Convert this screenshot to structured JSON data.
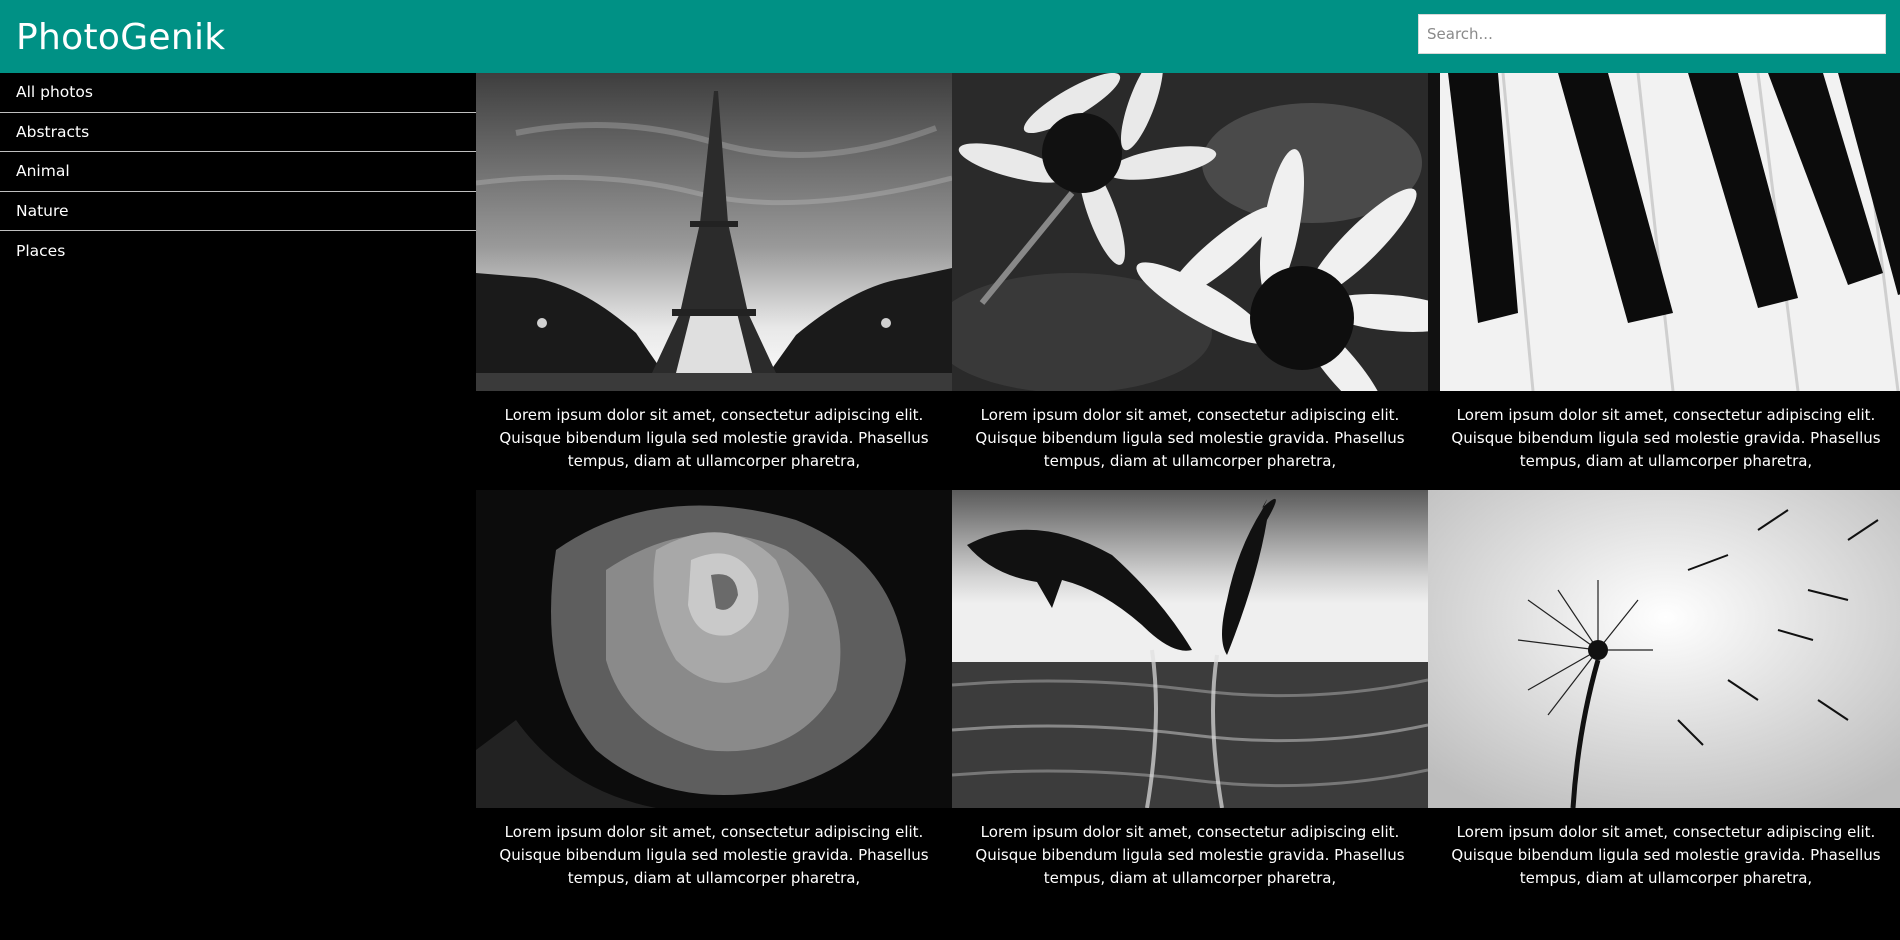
{
  "app": {
    "title": "PhotoGenik",
    "brand_color": "#009185"
  },
  "search": {
    "placeholder": "Search...",
    "value": ""
  },
  "sidebar": {
    "items": [
      {
        "label": "All photos"
      },
      {
        "label": "Abstracts"
      },
      {
        "label": "Animal"
      },
      {
        "label": "Nature"
      },
      {
        "label": "Places"
      }
    ]
  },
  "gallery": {
    "photos": [
      {
        "subject": "eiffel-tower",
        "caption": "Lorem ipsum dolor sit amet, consectetur adipiscing elit. Quisque bibendum ligula sed molestie gravida. Phasellus tempus, diam at ullamcorper pharetra,"
      },
      {
        "subject": "daisies",
        "caption": "Lorem ipsum dolor sit amet, consectetur adipiscing elit. Quisque bibendum ligula sed molestie gravida. Phasellus tempus, diam at ullamcorper pharetra,"
      },
      {
        "subject": "piano-keys",
        "caption": "Lorem ipsum dolor sit amet, consectetur adipiscing elit. Quisque bibendum ligula sed molestie gravida. Phasellus tempus, diam at ullamcorper pharetra,"
      },
      {
        "subject": "rose",
        "caption": "Lorem ipsum dolor sit amet, consectetur adipiscing elit. Quisque bibendum ligula sed molestie gravida. Phasellus tempus, diam at ullamcorper pharetra,"
      },
      {
        "subject": "dolphins",
        "caption": "Lorem ipsum dolor sit amet, consectetur adipiscing elit. Quisque bibendum ligula sed molestie gravida. Phasellus tempus, diam at ullamcorper pharetra,"
      },
      {
        "subject": "dandelion",
        "caption": "Lorem ipsum dolor sit amet, consectetur adipiscing elit. Quisque bibendum ligula sed molestie gravida. Phasellus tempus, diam at ullamcorper pharetra,"
      }
    ]
  }
}
